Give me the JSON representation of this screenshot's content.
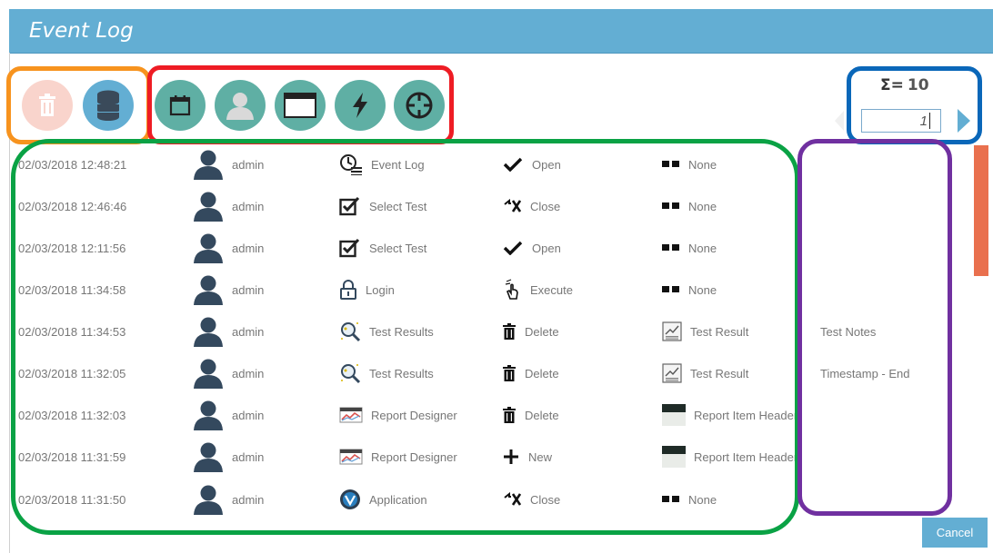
{
  "window": {
    "title": "Event Log"
  },
  "toolbar": {
    "delete_icon": "trash-icon",
    "database_icon": "database-icon",
    "filters": [
      {
        "name": "calendar-filter",
        "icon": "calendar-icon"
      },
      {
        "name": "user-filter",
        "icon": "user-icon"
      },
      {
        "name": "window-filter",
        "icon": "window-icon"
      },
      {
        "name": "action-filter",
        "icon": "lightning-icon"
      },
      {
        "name": "target-filter",
        "icon": "crosshair-icon"
      }
    ]
  },
  "pager": {
    "sigma_label": "Σ=",
    "total": "10",
    "page_value": "1"
  },
  "rows": [
    {
      "date": "02/03/2018 12:48:21",
      "user": "admin",
      "module": "Event Log",
      "module_icon": "event-log-icon",
      "action": "Open",
      "action_icon": "check-icon",
      "object": "None",
      "object_icon": "none-icon",
      "note": ""
    },
    {
      "date": "02/03/2018 12:46:46",
      "user": "admin",
      "module": "Select Test",
      "module_icon": "checkbox-icon",
      "action": "Close",
      "action_icon": "close-action-icon",
      "object": "None",
      "object_icon": "none-icon",
      "note": ""
    },
    {
      "date": "02/03/2018 12:11:56",
      "user": "admin",
      "module": "Select Test",
      "module_icon": "checkbox-icon",
      "action": "Open",
      "action_icon": "check-icon",
      "object": "None",
      "object_icon": "none-icon",
      "note": ""
    },
    {
      "date": "02/03/2018 11:34:58",
      "user": "admin",
      "module": "Login",
      "module_icon": "lock-icon",
      "action": "Execute",
      "action_icon": "pointer-icon",
      "object": "None",
      "object_icon": "none-icon",
      "note": ""
    },
    {
      "date": "02/03/2018 11:34:53",
      "user": "admin",
      "module": "Test Results",
      "module_icon": "magnifier-icon",
      "action": "Delete",
      "action_icon": "trash-icon",
      "object": "Test Result",
      "object_icon": "chart-doc-icon",
      "note": "Test Notes"
    },
    {
      "date": "02/03/2018 11:32:05",
      "user": "admin",
      "module": "Test Results",
      "module_icon": "magnifier-icon",
      "action": "Delete",
      "action_icon": "trash-icon",
      "object": "Test Result",
      "object_icon": "chart-doc-icon",
      "note": "Timestamp - End"
    },
    {
      "date": "02/03/2018 11:32:03",
      "user": "admin",
      "module": "Report Designer",
      "module_icon": "report-icon",
      "action": "Delete",
      "action_icon": "trash-icon",
      "object": "Report Item Header",
      "object_icon": "header-icon",
      "note": ""
    },
    {
      "date": "02/03/2018 11:31:59",
      "user": "admin",
      "module": "Report Designer",
      "module_icon": "report-icon",
      "action": "New",
      "action_icon": "plus-icon",
      "object": "Report Item Header",
      "object_icon": "header-icon",
      "note": ""
    },
    {
      "date": "02/03/2018 11:31:50",
      "user": "admin",
      "module": "Application",
      "module_icon": "app-logo-icon",
      "action": "Close",
      "action_icon": "close-action-icon",
      "object": "None",
      "object_icon": "none-icon",
      "note": ""
    }
  ],
  "footer": {
    "cancel_label": "Cancel"
  },
  "colors": {
    "titlebar": "#63aed3",
    "teal": "#5fafa4",
    "orange_outline": "#f7931e",
    "red_outline": "#ee1c24",
    "blue_outline": "#0a67b9",
    "green_outline": "#0aa245",
    "purple_outline": "#7030a0",
    "scrollbar": "#e9704e"
  }
}
